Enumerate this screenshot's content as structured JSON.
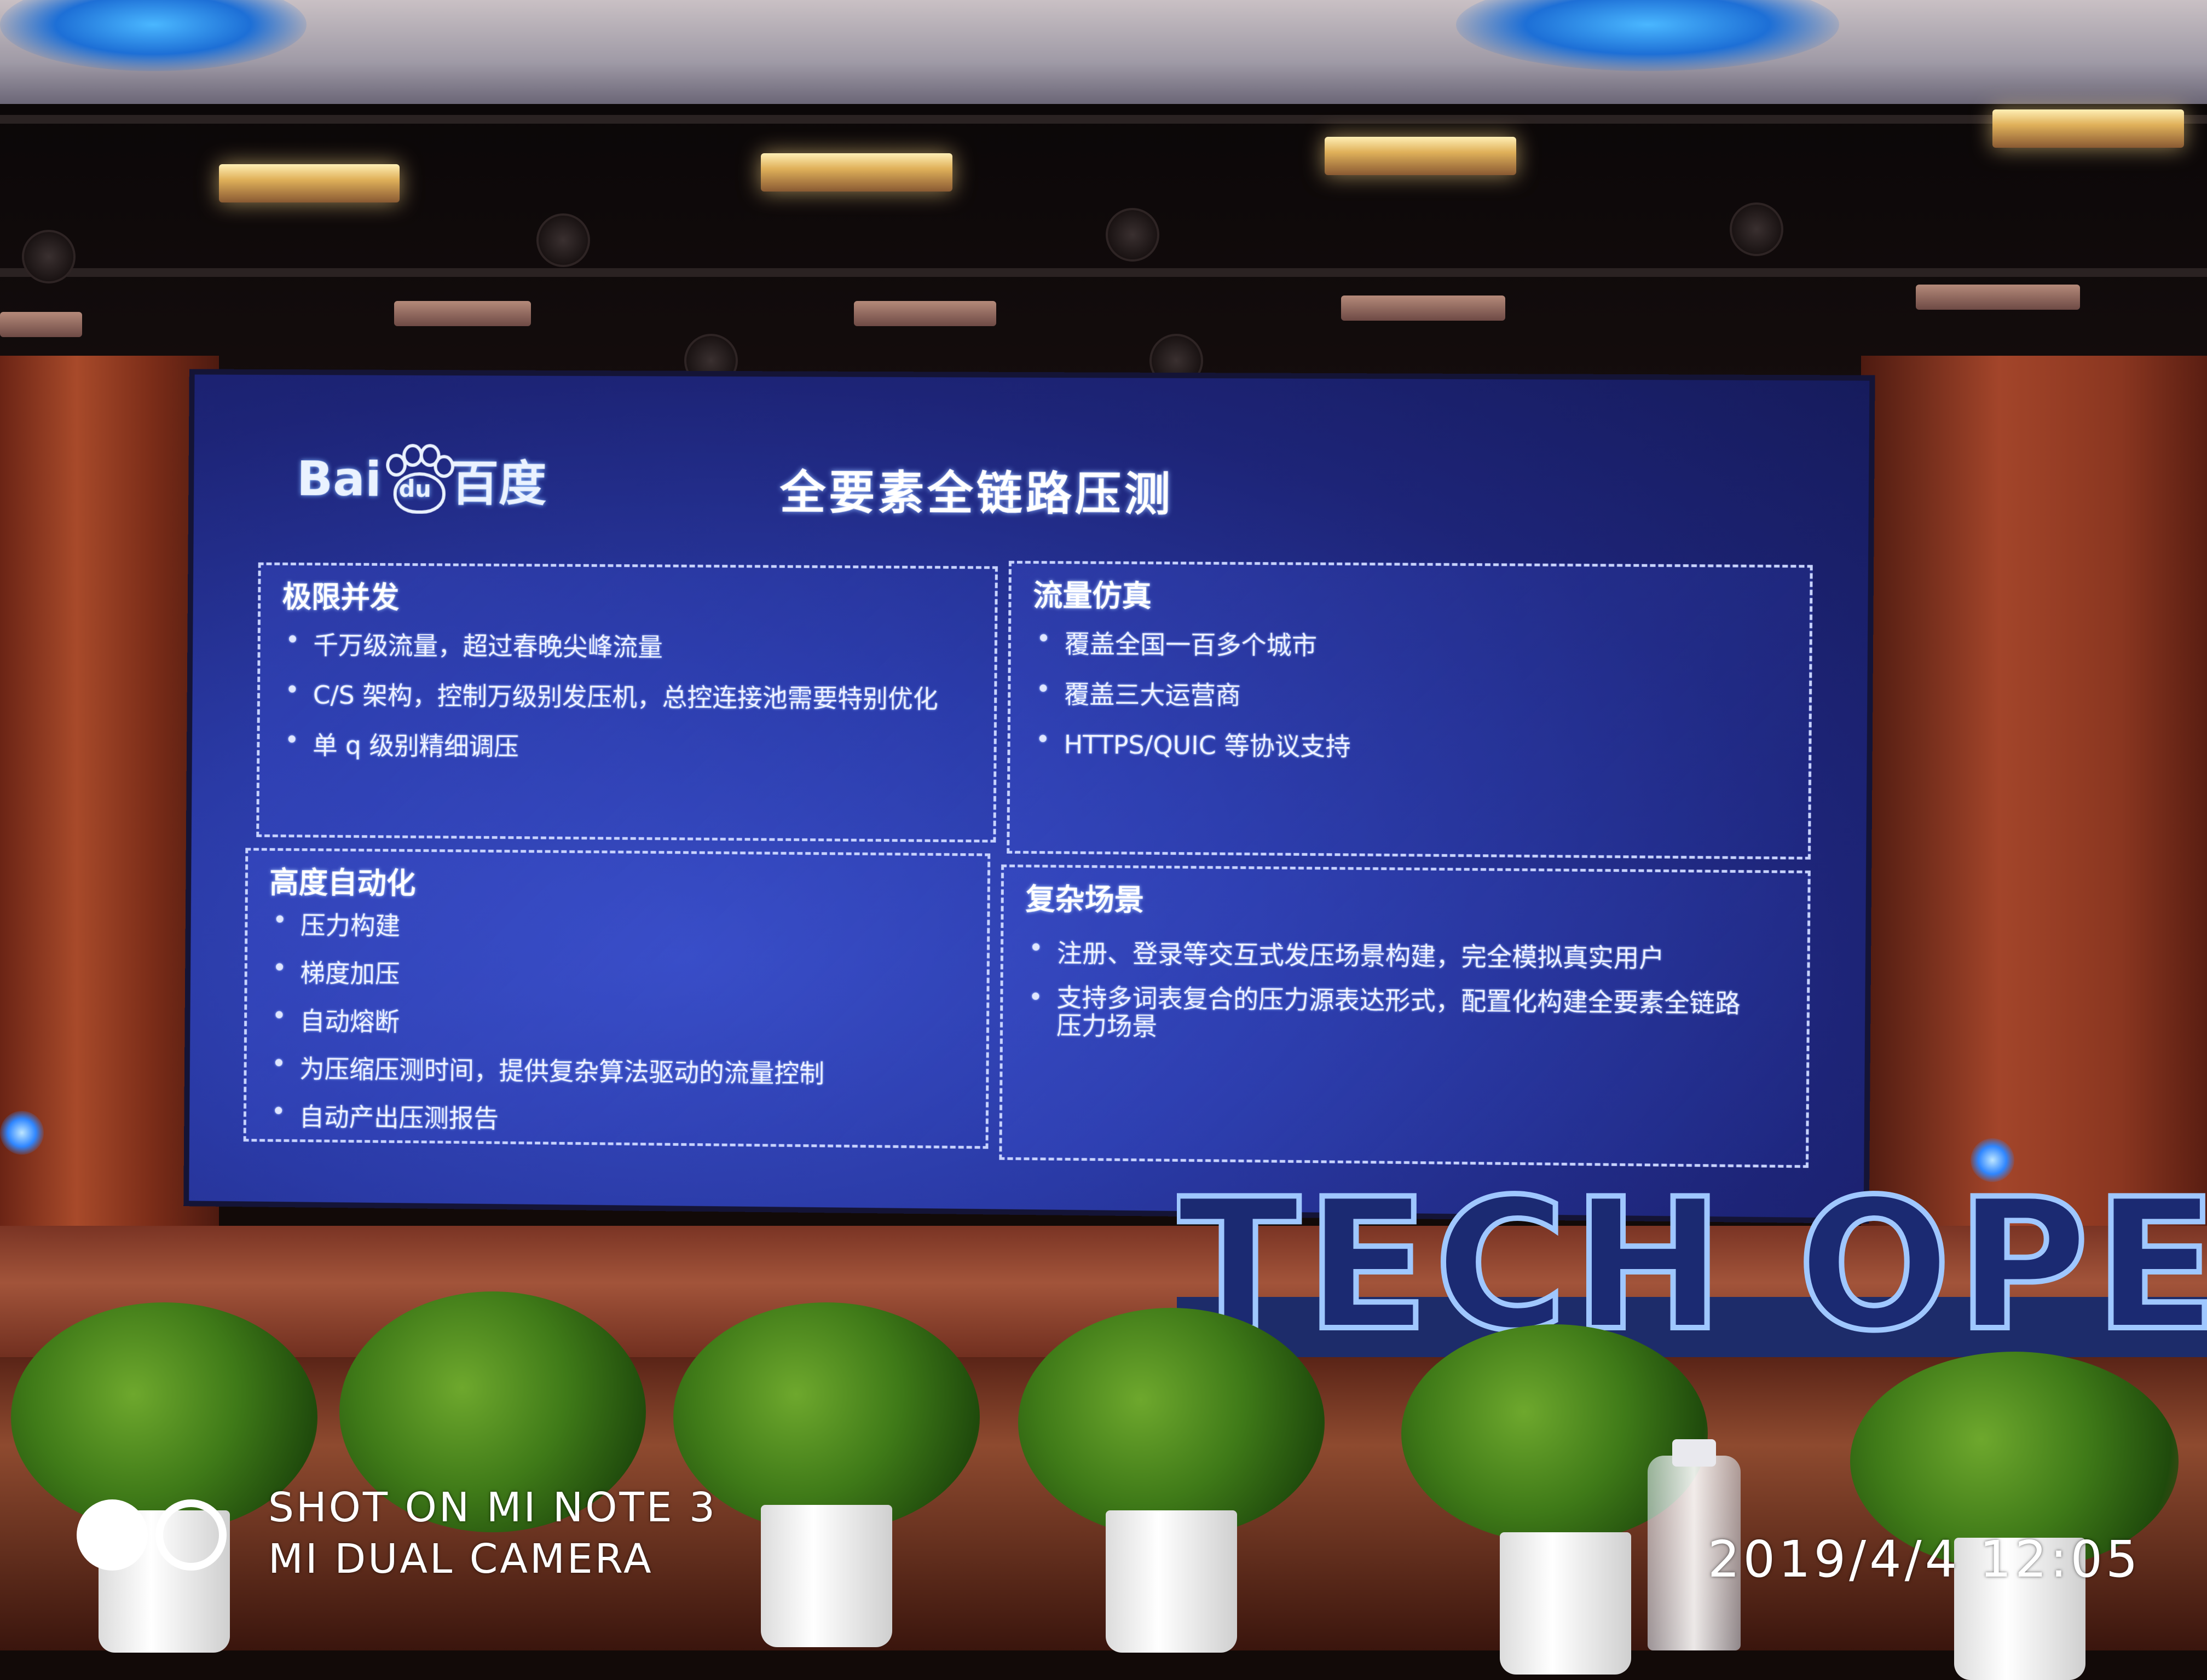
{
  "slide": {
    "logo": {
      "bai": "Bai",
      "du": "du",
      "cn": "百度"
    },
    "title": "全要素全链路压测",
    "panels": [
      {
        "title": "极限并发",
        "items": [
          "千万级流量，超过春晚尖峰流量",
          "C/S 架构，控制万级别发压机，总控连接池需要特别优化",
          "单 q 级别精细调压"
        ]
      },
      {
        "title": "流量仿真",
        "items": [
          "覆盖全国一百多个城市",
          "覆盖三大运营商",
          "HTTPS/QUIC 等协议支持"
        ]
      },
      {
        "title": "高度自动化",
        "items": [
          "压力构建",
          "梯度加压",
          "自动熔断",
          "为压缩压测时间，提供复杂算法驱动的流量控制",
          "自动产出压测报告"
        ]
      },
      {
        "title": "复杂场景",
        "items": [
          "注册、登录等交互式发压场景构建，完全模拟真实用户",
          "支持多词表复合的压力源表达形式，配置化构建全要素全链路压力场景"
        ]
      }
    ],
    "bullet": "•"
  },
  "stage": {
    "sign_text": "TECH OPEN DA"
  },
  "watermark": {
    "line1": "SHOT ON MI NOTE 3",
    "line2": "MI DUAL CAMERA",
    "datetime": "2019/4/4  12:05"
  },
  "colors": {
    "slide_bg": "#1d2477",
    "panel_border": "#c8d3ff",
    "sign_fill": "#1b2a72",
    "sign_stroke": "#9fc7ff",
    "wall": "#a84a2a"
  }
}
